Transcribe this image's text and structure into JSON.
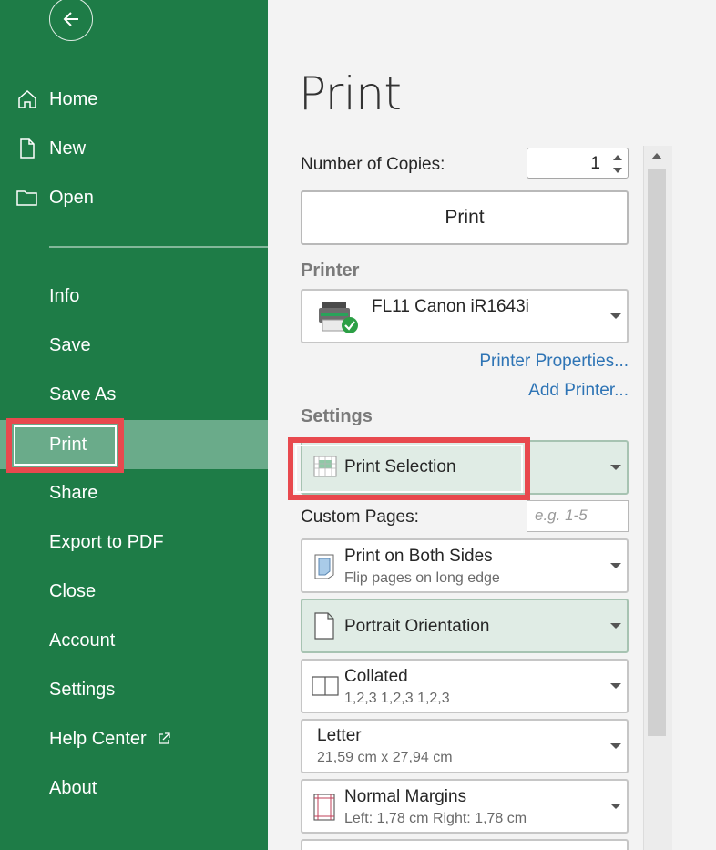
{
  "sidebar": {
    "nav_top": [
      {
        "label": "Home",
        "icon": "home-icon"
      },
      {
        "label": "New",
        "icon": "new-document-icon"
      },
      {
        "label": "Open",
        "icon": "folder-icon"
      }
    ],
    "nav_bottom": [
      {
        "label": "Info"
      },
      {
        "label": "Save"
      },
      {
        "label": "Save As"
      },
      {
        "label": "Print",
        "active": true
      },
      {
        "label": "Share"
      },
      {
        "label": "Export to PDF"
      },
      {
        "label": "Close"
      },
      {
        "label": "Account"
      },
      {
        "label": "Settings"
      },
      {
        "label": "Help Center",
        "icon": "external-link-icon"
      },
      {
        "label": "About"
      }
    ]
  },
  "main": {
    "title": "Print",
    "copies_label": "Number of Copies:",
    "copies_value": "1",
    "print_button": "Print",
    "printer_heading": "Printer",
    "printer_name": "FL11 Canon iR1643i",
    "printer_properties_link": "Printer Properties...",
    "add_printer_link": "Add Printer...",
    "settings_heading": "Settings",
    "print_selection": "Print Selection",
    "custom_pages_label": "Custom Pages:",
    "custom_pages_placeholder": "e.g. 1-5",
    "duplex_title": "Print on Both Sides",
    "duplex_sub": "Flip pages on long edge",
    "orientation_title": "Portrait Orientation",
    "collated_title": "Collated",
    "collated_sub": "1,2,3 1,2,3 1,2,3",
    "paper_title": "Letter",
    "paper_sub": "21,59 cm x 27,94 cm",
    "margins_title": "Normal Margins",
    "margins_sub": "Left: 1,78 cm  Right: 1,78 cm"
  },
  "colors": {
    "sidebar_bg": "#1e7c47",
    "active_bg": "#6aab8a",
    "highlight": "#e8494e",
    "link": "#2e74b5"
  }
}
